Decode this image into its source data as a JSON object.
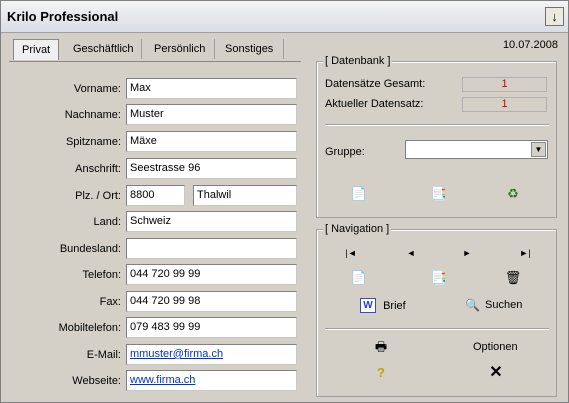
{
  "window": {
    "title": "Krilo Professional",
    "menu_icon": "arrow-down-icon"
  },
  "date": "10.07.2008",
  "tabs": [
    "Privat",
    "Geschäftlich",
    "Persönlich",
    "Sonstiges"
  ],
  "form": {
    "vorname": {
      "label": "Vorname:",
      "value": "Max"
    },
    "nachname": {
      "label": "Nachname:",
      "value": "Muster"
    },
    "spitzname": {
      "label": "Spitzname:",
      "value": "Mäxe"
    },
    "anschrift": {
      "label": "Anschrift:",
      "value": "Seestrasse 96"
    },
    "plz_ort": {
      "label": "Plz. / Ort:",
      "plz": "8800",
      "ort": "Thalwil"
    },
    "land": {
      "label": "Land:",
      "value": "Schweiz"
    },
    "bundesland": {
      "label": "Bundesland:",
      "value": ""
    },
    "telefon": {
      "label": "Telefon:",
      "value": "044 720 99 99"
    },
    "fax": {
      "label": "Fax:",
      "value": "044 720 99 98"
    },
    "mobil": {
      "label": "Mobiltelefon:",
      "value": "079 483 99 99"
    },
    "email": {
      "label": "E-Mail:",
      "value": "mmuster@firma.ch"
    },
    "web": {
      "label": "Webseite:",
      "value": "www.firma.ch"
    }
  },
  "datenbank": {
    "title": "[ Datenbank ]",
    "total_label": "Datensätze Gesamt:",
    "total_value": "1",
    "current_label": "Aktueller Datensatz:",
    "current_value": "1",
    "gruppe_label": "Gruppe:",
    "gruppe_value": "",
    "icons": [
      "new-document-icon",
      "edit-document-icon",
      "recycle-bin-icon"
    ]
  },
  "navigation": {
    "title": "[ Navigation ]",
    "first": "|◄",
    "prev": "◄",
    "next": "►",
    "last": "►|",
    "icons": [
      "new-record-icon",
      "edit-record-icon",
      "delete-icon"
    ],
    "brief_label": "Brief",
    "suchen_label": "Suchen",
    "optionen_label": "Optionen"
  },
  "colors": {
    "accent_link": "#0033cc",
    "count_red": "#cc0000"
  }
}
